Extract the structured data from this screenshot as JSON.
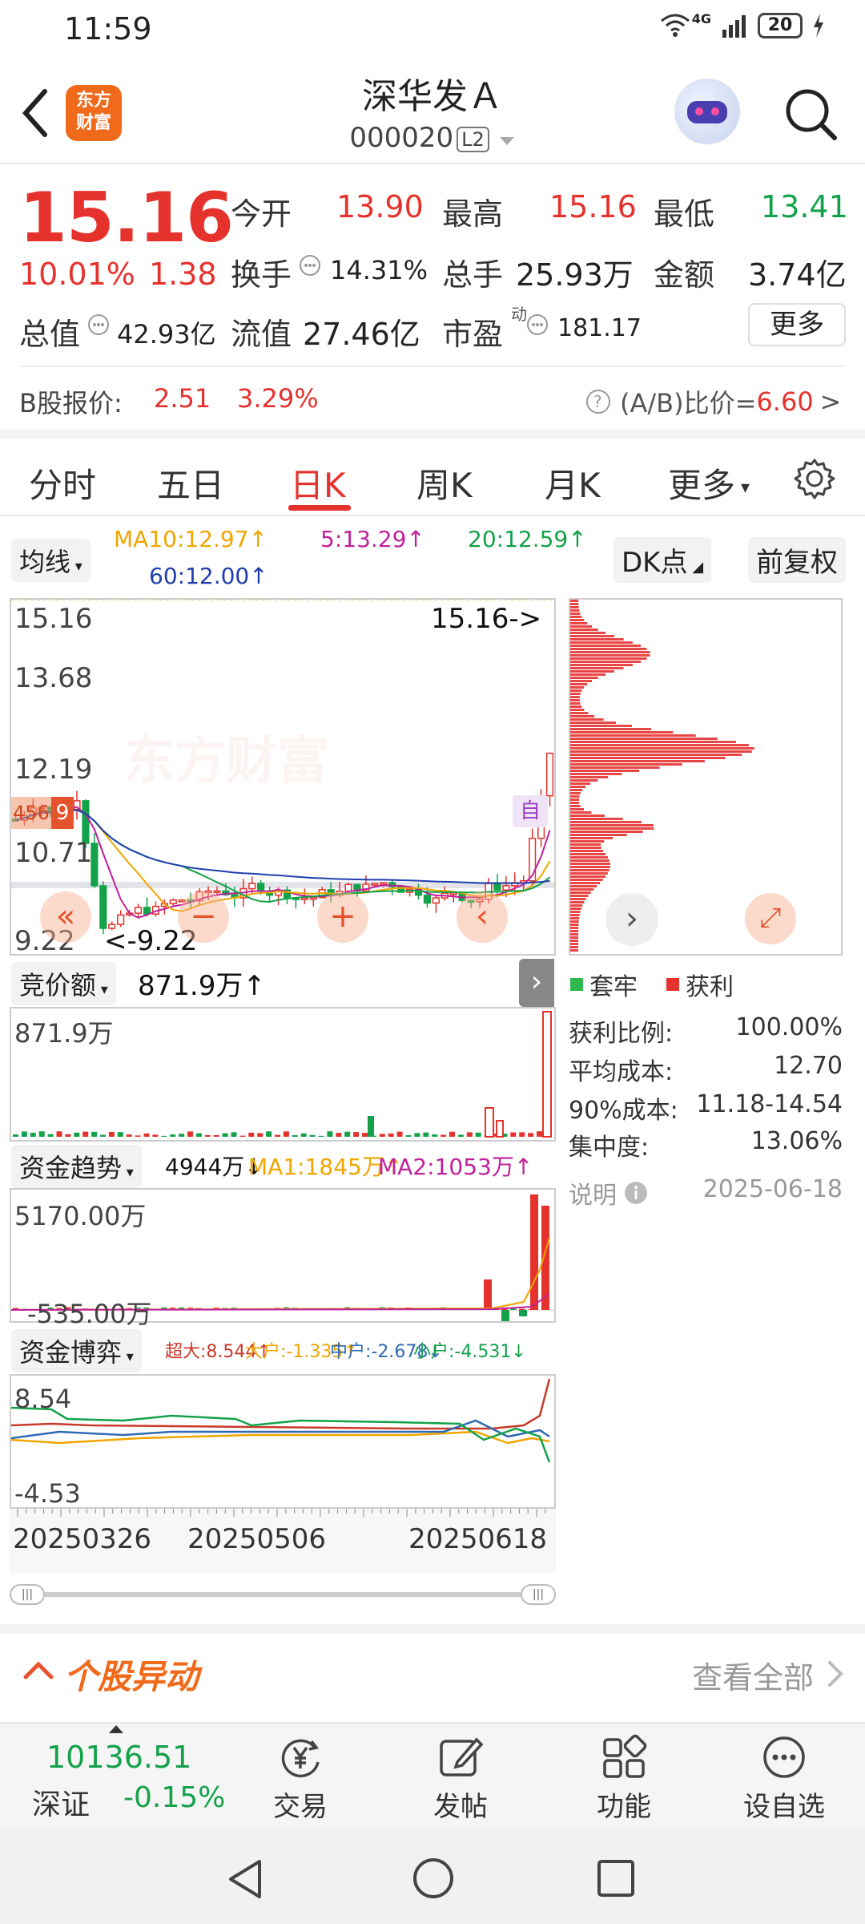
{
  "status_bar": {
    "time": "11:59",
    "network": "4G",
    "battery": "20"
  },
  "header": {
    "logo_text_1": "东方",
    "logo_text_2": "财富",
    "stock_name": "深华发Ａ",
    "stock_code": "000020",
    "level_badge": "L2"
  },
  "quote": {
    "price": "15.16",
    "change_pct": "10.01%",
    "change_amt": "1.38",
    "open_label": "今开",
    "open": "13.90",
    "high_label": "最高",
    "high": "15.16",
    "low_label": "最低",
    "low": "13.41",
    "turnover_label": "换手",
    "turnover": "14.31%",
    "volume_label": "总手",
    "volume": "25.93万",
    "amount_label": "金额",
    "amount": "3.74亿",
    "mktcap_label": "总值",
    "mktcap": "42.93亿",
    "float_label": "流值",
    "float_cap": "27.46亿",
    "pe_label": "市盈",
    "pe_sup": "动",
    "pe": "181.17",
    "more_button": "更多"
  },
  "b_share": {
    "label": "B股报价:",
    "price": "2.51",
    "pct": "3.29%",
    "ab_label": "(A/B)比价=",
    "ab_value": "6.60",
    "arrow": ">"
  },
  "tabs": [
    {
      "label": "分时"
    },
    {
      "label": "五日"
    },
    {
      "label": "日K"
    },
    {
      "label": "周K"
    },
    {
      "label": "月K"
    },
    {
      "label": "更多"
    }
  ],
  "ma_bar": {
    "selector": "均线",
    "ma10": "MA10:12.97↑",
    "ma5": "5:13.29↑",
    "ma20": "20:12.59↑",
    "ma60": "60:12.00↑",
    "dk_button": "DK点",
    "fq_button": "前复权"
  },
  "kline": {
    "y_labels": [
      "15.16",
      "13.68",
      "12.19",
      "10.71",
      "9.22"
    ],
    "max_marker": "15.16->",
    "min_marker": "<-9.22",
    "side_badge": "自",
    "side_tag_text": "456",
    "side_tag_num": "9",
    "watermark": "东方财富",
    "buttons": {
      "rewind": "«",
      "zoom_out": "−",
      "zoom_in": "+",
      "prev": "‹"
    }
  },
  "chips": {
    "next": "›",
    "expand": "⤢",
    "legend_trapped": "套牢",
    "legend_profit": "获利",
    "stats": [
      {
        "label": "获利比例:",
        "value": "100.00%"
      },
      {
        "label": "平均成本:",
        "value": "12.70"
      },
      {
        "label": "90%成本:",
        "value": "11.18-14.54"
      },
      {
        "label": "集中度:",
        "value": "13.06%"
      }
    ],
    "note_label": "说明",
    "date": "2025-06-18"
  },
  "bid_volume": {
    "selector": "竞价额",
    "value": "871.9万↑",
    "y_top": "871.9万"
  },
  "fund_trend": {
    "selector": "资金趋势",
    "value": "4944万↓",
    "ma1": "MA1:1845万↑",
    "ma2": "MA2:1053万↑",
    "y_top": "5170.00万",
    "y_bottom": "-535.00万"
  },
  "fund_game": {
    "selector": "资金博弈",
    "super": "超大:8.544↑",
    "large": "大户:-1.335↑",
    "mid": "中户:-2.678↓",
    "small": "小户:-4.531↓",
    "y_top": "8.54",
    "y_bottom": "-4.53"
  },
  "x_dates": [
    "20250326",
    "20250506",
    "20250618"
  ],
  "alerts": {
    "title": "个股异动",
    "view_all": "查看全部"
  },
  "bottom_nav": {
    "index_value": "10136.51",
    "index_name": "深证",
    "index_change": "-0.15%",
    "items": [
      {
        "label": "交易"
      },
      {
        "label": "发帖"
      },
      {
        "label": "功能"
      },
      {
        "label": "设自选"
      }
    ]
  },
  "colors": {
    "up": "#e5322d",
    "down": "#13a24a",
    "accent": "#e5322d",
    "brand": "#f06a1b"
  }
}
